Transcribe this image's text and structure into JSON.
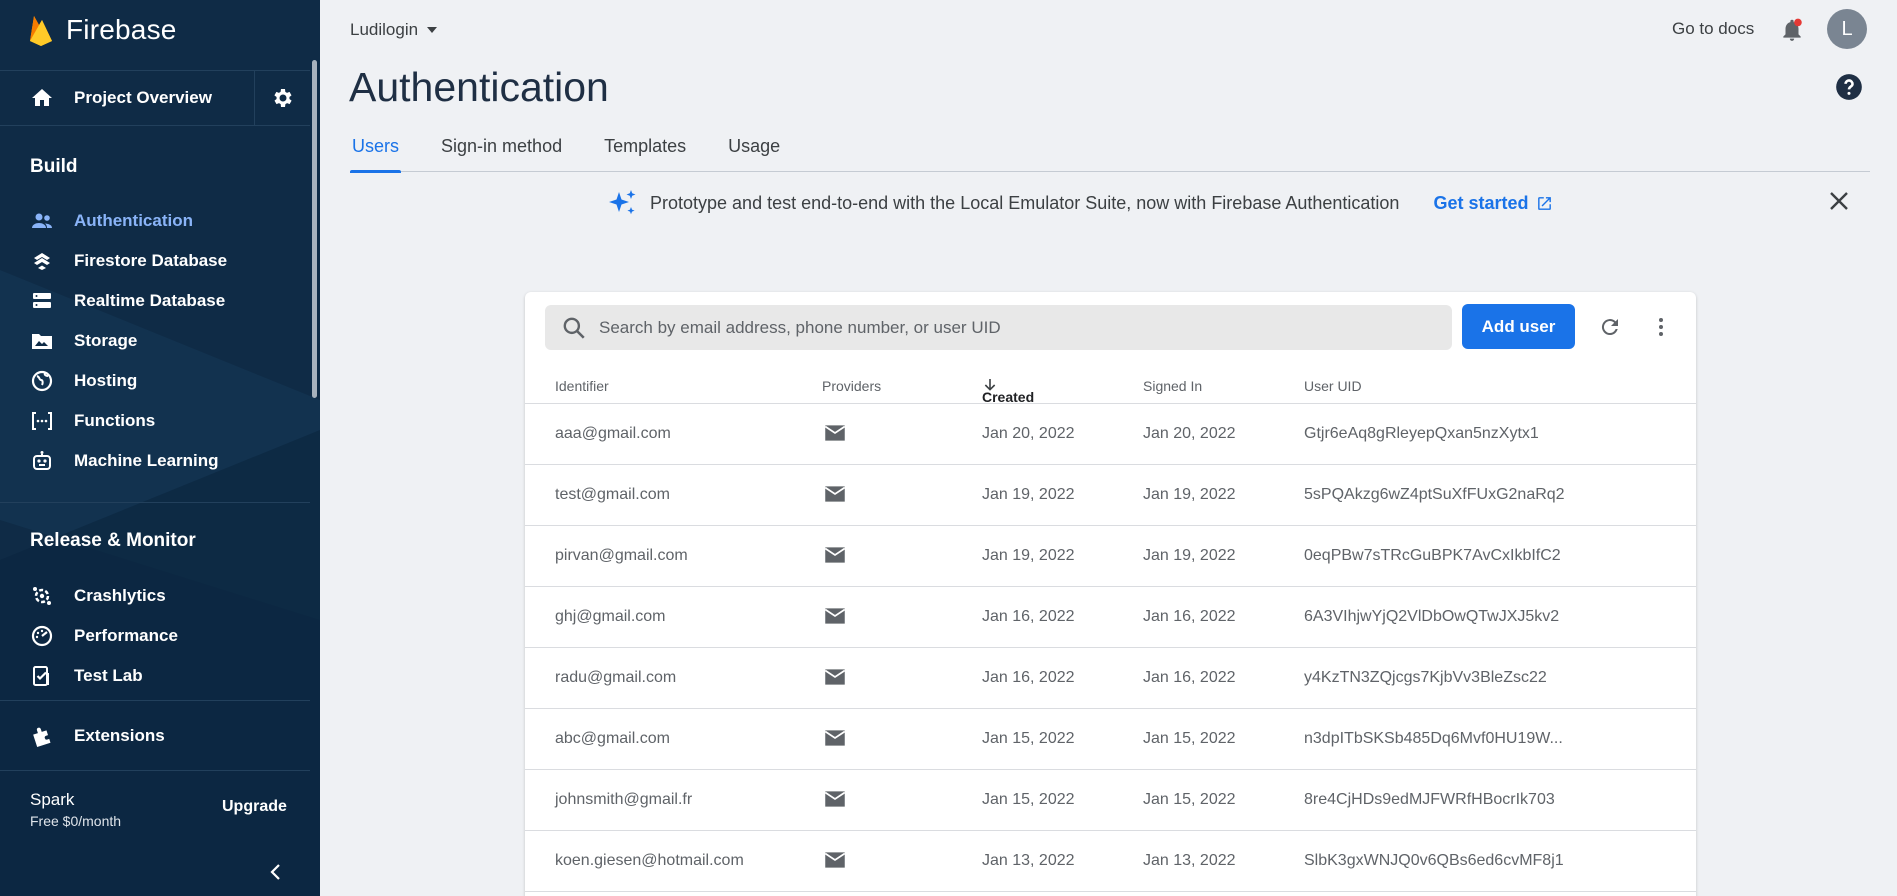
{
  "app": {
    "name": "Firebase"
  },
  "sidebar": {
    "project_overview": "Project Overview",
    "build_title": "Build",
    "build_items": [
      {
        "label": "Authentication",
        "icon": "people-icon",
        "active": true
      },
      {
        "label": "Firestore Database",
        "icon": "firestore-icon"
      },
      {
        "label": "Realtime Database",
        "icon": "database-icon"
      },
      {
        "label": "Storage",
        "icon": "storage-icon"
      },
      {
        "label": "Hosting",
        "icon": "globe-icon"
      },
      {
        "label": "Functions",
        "icon": "functions-icon"
      },
      {
        "label": "Machine Learning",
        "icon": "robot-icon"
      }
    ],
    "release_title": "Release & Monitor",
    "release_items": [
      {
        "label": "Crashlytics",
        "icon": "crashlytics-icon"
      },
      {
        "label": "Performance",
        "icon": "performance-icon"
      },
      {
        "label": "Test Lab",
        "icon": "testlab-icon"
      }
    ],
    "extensions": "Extensions",
    "plan_name": "Spark",
    "plan_price": "Free $0/month",
    "upgrade": "Upgrade"
  },
  "header": {
    "project": "Ludilogin",
    "docs": "Go to docs",
    "avatar_letter": "L",
    "title": "Authentication"
  },
  "tabs": [
    "Users",
    "Sign-in method",
    "Templates",
    "Usage"
  ],
  "banner": {
    "text": "Prototype and test end-to-end with the Local Emulator Suite, now with Firebase Authentication",
    "link": "Get started"
  },
  "users": {
    "search_placeholder": "Search by email address, phone number, or user UID",
    "add_user": "Add user",
    "columns": [
      "Identifier",
      "Providers",
      "Created",
      "Signed In",
      "User UID"
    ],
    "rows": [
      {
        "identifier": "aaa@gmail.com",
        "created": "Jan 20, 2022",
        "signed_in": "Jan 20, 2022",
        "uid": "Gtjr6eAq8gRleyepQxan5nzXytx1"
      },
      {
        "identifier": "test@gmail.com",
        "created": "Jan 19, 2022",
        "signed_in": "Jan 19, 2022",
        "uid": "5sPQAkzg6wZ4ptSuXfFUxG2naRq2"
      },
      {
        "identifier": "pirvan@gmail.com",
        "created": "Jan 19, 2022",
        "signed_in": "Jan 19, 2022",
        "uid": "0eqPBw7sTRcGuBPK7AvCxIkbIfC2"
      },
      {
        "identifier": "ghj@gmail.com",
        "created": "Jan 16, 2022",
        "signed_in": "Jan 16, 2022",
        "uid": "6A3VIhjwYjQ2VlDbOwQTwJXJ5kv2"
      },
      {
        "identifier": "radu@gmail.com",
        "created": "Jan 16, 2022",
        "signed_in": "Jan 16, 2022",
        "uid": "y4KzTN3ZQjcgs7KjbVv3BleZsc22"
      },
      {
        "identifier": "abc@gmail.com",
        "created": "Jan 15, 2022",
        "signed_in": "Jan 15, 2022",
        "uid": "n3dpITbSKSb485Dq6Mvf0HU19W..."
      },
      {
        "identifier": "johnsmith@gmail.fr",
        "created": "Jan 15, 2022",
        "signed_in": "Jan 15, 2022",
        "uid": "8re4CjHDs9edMJFWRfHBocrIk703"
      },
      {
        "identifier": "koen.giesen@hotmail.com",
        "created": "Jan 13, 2022",
        "signed_in": "Jan 13, 2022",
        "uid": "SlbK3gxWNJQ0v6QBs6ed6cvMF8j1"
      }
    ]
  },
  "colors": {
    "accent": "#1a73e8",
    "sidebar": "#0f2b46",
    "active_nav": "#8ab4f8"
  }
}
